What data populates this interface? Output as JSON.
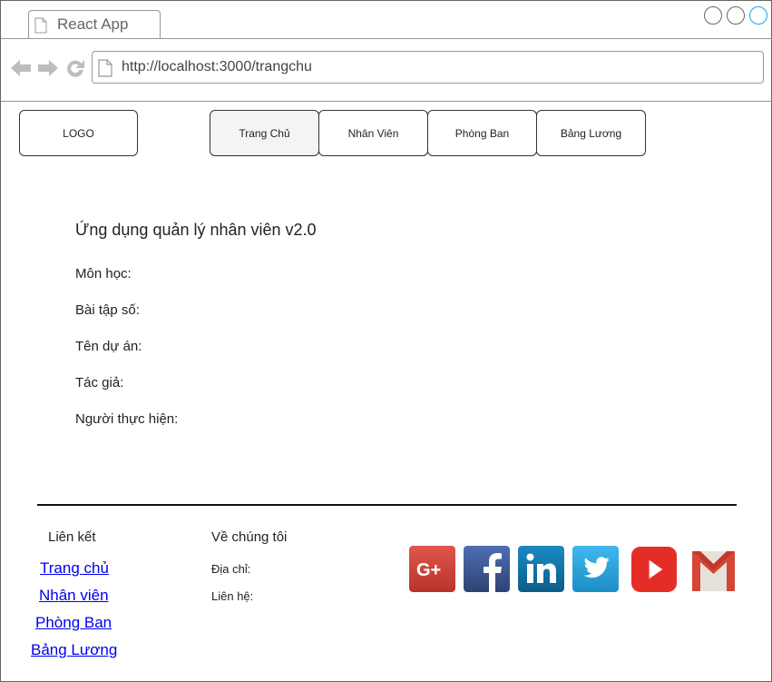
{
  "browser": {
    "tab_title": "React App",
    "url": "http://localhost:3000/trangchu"
  },
  "nav": {
    "logo": "LOGO",
    "items": [
      "Trang Chủ",
      "Nhân Viên",
      "Phòng Ban",
      "Bảng Lương"
    ]
  },
  "content": {
    "title": "Ứng dụng quản lý nhân viên v2.0",
    "rows": [
      "Môn học:",
      "Bài tập số:",
      "Tên dự án:",
      "Tác giả:",
      "Người thực hiện:"
    ]
  },
  "footer": {
    "links_heading": "Liên kết",
    "links": [
      "Trang chủ",
      "Nhân viên",
      "Phòng Ban",
      "Bảng Lương"
    ],
    "about_heading": "Về chúng tôi",
    "address_label": "Địa chỉ:",
    "contact_label": "Liên hệ:",
    "social": [
      {
        "name": "google-plus-icon",
        "color": "#d2433a"
      },
      {
        "name": "facebook-icon",
        "color": "#3b5998"
      },
      {
        "name": "linkedin-icon",
        "color": "#0e76a8"
      },
      {
        "name": "twitter-icon",
        "color": "#2aa9e0"
      },
      {
        "name": "youtube-icon",
        "color": "#e52d27"
      },
      {
        "name": "gmail-icon",
        "color": "#d44638"
      }
    ]
  }
}
